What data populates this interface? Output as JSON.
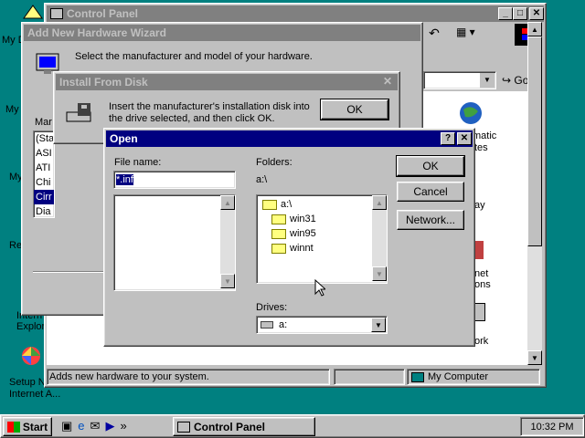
{
  "desktop": {
    "icons": [
      {
        "label": "My D"
      },
      {
        "label": "My"
      },
      {
        "label": "My"
      },
      {
        "label": "Re"
      },
      {
        "label": "Intern\nExplor"
      },
      {
        "label": "Setup N\nInternet A..."
      }
    ]
  },
  "control_panel": {
    "title": "Control Panel",
    "address_go": "Go",
    "status_text": "Adds new hardware to your system.",
    "status_location": "My Computer",
    "partial_items": [
      "matic",
      "tes",
      "ay",
      "net",
      "ons",
      "ork"
    ]
  },
  "wizard": {
    "title": "Add New Hardware Wizard",
    "instruction": "Select the manufacturer and model of your hardware.",
    "manufacturers_label": "Mar",
    "manufacturers": [
      "(Sta",
      "ASI",
      "ATI",
      "Chi",
      "Cirr",
      "Dia"
    ],
    "selected_index": 4
  },
  "install_disk": {
    "title": "Install From Disk",
    "message": "Insert the manufacturer's installation disk into the drive selected, and then click OK.",
    "ok_label": "OK"
  },
  "open_dialog": {
    "title": "Open",
    "help_btn": "?",
    "close_btn": "✕",
    "file_name_label": "File name:",
    "file_name_value": "*.inf",
    "folders_label": "Folders:",
    "current_path": "a:\\",
    "folders": [
      "a:\\",
      "win31",
      "win95",
      "winnt"
    ],
    "drives_label": "Drives:",
    "drive_value": "a:",
    "ok_label": "OK",
    "cancel_label": "Cancel",
    "network_label": "Network..."
  },
  "taskbar": {
    "start_label": "Start",
    "task_label": "Control Panel",
    "clock": "10:32 PM"
  },
  "colors": {
    "desktop": "#008080",
    "active_title": "#000080",
    "inactive_title": "#808080",
    "face": "#c0c0c0"
  }
}
